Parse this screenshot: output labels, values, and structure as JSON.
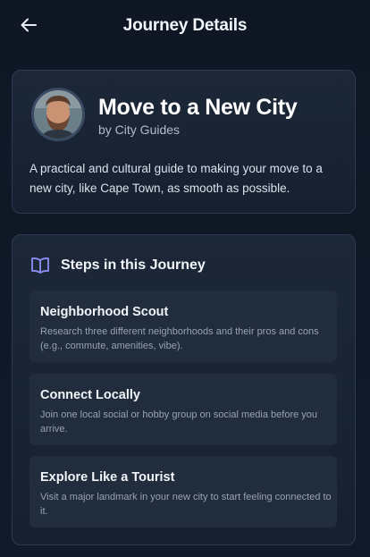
{
  "header": {
    "title": "Journey Details",
    "back_icon": "arrow-left-icon"
  },
  "journey": {
    "title": "Move to a New City",
    "author": "by City Guides",
    "description": "A practical and cultural guide to making your move to a new city, like Cape Town, as smooth as possible."
  },
  "steps_section": {
    "title": "Steps in this Journey",
    "icon": "book-open-icon",
    "icon_color": "#8b8ff5",
    "items": [
      {
        "title": "Neighborhood Scout",
        "description": "Research three different neighborhoods and their pros and cons (e.g., commute, amenities, vibe)."
      },
      {
        "title": "Connect Locally",
        "description": "Join one local social or hobby group on social media before you arrive."
      },
      {
        "title": "Explore Like a Tourist",
        "description": "Visit a major landmark in your new city to start feeling connected to it."
      }
    ]
  }
}
